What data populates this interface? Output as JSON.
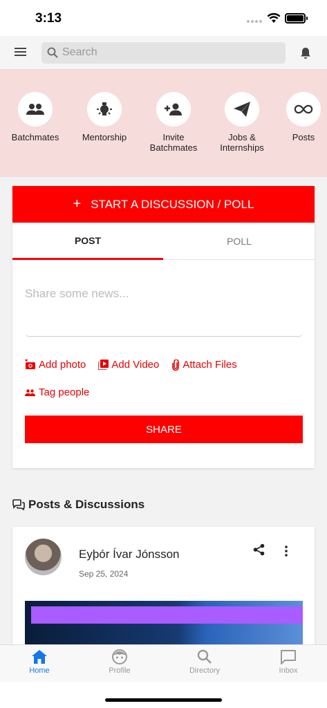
{
  "status_bar": {
    "time": "3:13"
  },
  "search": {
    "placeholder": "Search"
  },
  "quick_actions": [
    {
      "label": "Batchmates",
      "icon": "group-icon"
    },
    {
      "label": "Mentorship",
      "icon": "lightbulb-icon"
    },
    {
      "label": "Invite\nBatchmates",
      "icon": "person-add-icon"
    },
    {
      "label": "Jobs &\nInternships",
      "icon": "send-icon"
    },
    {
      "label": "Posts",
      "icon": "infinity-icon"
    }
  ],
  "composer": {
    "start_label": "START A DISCUSSION / POLL",
    "tabs": [
      "POST",
      "POLL"
    ],
    "input_placeholder": "Share some news...",
    "attach": {
      "photo": "Add photo",
      "video": "Add Video",
      "files": "Attach Files"
    },
    "tag_label": "Tag people",
    "share_label": "SHARE"
  },
  "section": {
    "title": "Posts & Discussions"
  },
  "post": {
    "author": "Eyþór Ívar Jónsson",
    "date": "Sep 25, 2024"
  },
  "bottom_nav": [
    {
      "label": "Home",
      "active": true
    },
    {
      "label": "Profile",
      "active": false
    },
    {
      "label": "Directory",
      "active": false
    },
    {
      "label": "Inbox",
      "active": false
    }
  ],
  "colors": {
    "accent": "#ff0000",
    "quick_bg": "#f7dcdc",
    "nav_active": "#1677e6"
  }
}
